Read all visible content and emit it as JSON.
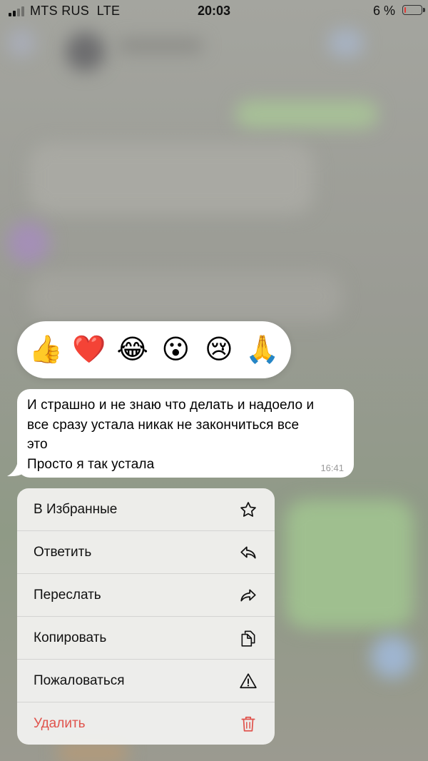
{
  "status_bar": {
    "carrier": "MTS RUS",
    "network": "LTE",
    "time": "20:03",
    "battery_percent": "6 %",
    "battery_color": "#e53935"
  },
  "reactions": [
    {
      "name": "thumbs-up",
      "glyph": "👍"
    },
    {
      "name": "heart",
      "glyph": "❤️"
    },
    {
      "name": "tears-of-joy",
      "glyph": "😂"
    },
    {
      "name": "astonished",
      "glyph": "😮"
    },
    {
      "name": "crying",
      "glyph": "😢"
    },
    {
      "name": "folded-hands",
      "glyph": "🙏"
    }
  ],
  "message": {
    "text": "И страшно и не знаю что делать и надоело и\nвсе сразу устала никак не закончиться все\nэто\nПросто я так устала",
    "time": "16:41"
  },
  "menu": {
    "items": [
      {
        "label": "В Избранные",
        "icon": "star-icon"
      },
      {
        "label": "Ответить",
        "icon": "reply-icon"
      },
      {
        "label": "Переслать",
        "icon": "forward-icon"
      },
      {
        "label": "Копировать",
        "icon": "copy-icon"
      },
      {
        "label": "Пожаловаться",
        "icon": "warning-icon"
      },
      {
        "label": "Удалить",
        "icon": "trash-icon"
      }
    ],
    "danger_color": "#e0534c"
  }
}
